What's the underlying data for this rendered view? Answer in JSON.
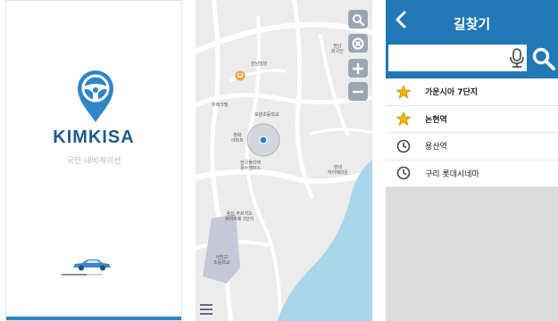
{
  "splash": {
    "brand": "KIMKISA",
    "tagline": "국민 내비게이션",
    "loading_progress": 0.6
  },
  "map": {
    "labels": {
      "hannam_villa": "한남빌딩",
      "hannam_embassy": "한남\n외국인",
      "imaeok": "이매크텔",
      "bogwang_school": "보광초등학교",
      "cheongho_apt": "청화\n아파트",
      "hankuk_univ": "한국폴리텍\n용수캠퍼스",
      "hyundai": "현대\n하이페리온",
      "yongsan_apt": "용산 푸르지오\n써미트웨 2단지",
      "seobinggo_school": "서빙고\n초등학교"
    },
    "icons": {
      "search": "search-icon",
      "layers": "layers-icon",
      "zoom_in": "plus-icon",
      "zoom_out": "minus-icon",
      "menu": "menu-icon",
      "poi": "bus-icon",
      "location": "location-dot-icon"
    },
    "colors": {
      "water": "#a9d6e8",
      "district": "#c5c8d6",
      "button": "#9ba6b4",
      "location": "#2b7fd6"
    }
  },
  "route": {
    "title": "길찾기",
    "search_value": "",
    "items": [
      {
        "type": "favorite",
        "icon": "star-icon",
        "label": "가운시아 7단지"
      },
      {
        "type": "favorite",
        "icon": "star-icon",
        "label": "논현역"
      },
      {
        "type": "recent",
        "icon": "clock-icon",
        "label": "용산역"
      },
      {
        "type": "recent",
        "icon": "clock-icon",
        "label": "구리 롯데시네마"
      }
    ],
    "colors": {
      "header": "#2178b5",
      "star": "#f5b400"
    }
  }
}
